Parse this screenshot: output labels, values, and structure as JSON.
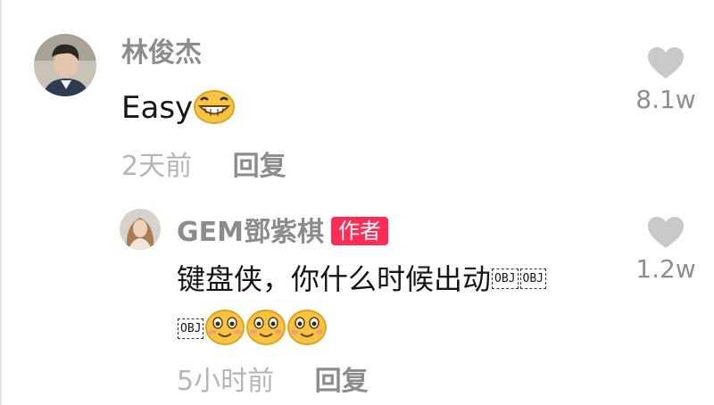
{
  "comments": [
    {
      "username": "林俊杰",
      "text": "Easy",
      "text_emoji": "grinning-face-emoji",
      "time": "2天前",
      "reply_label": "回复",
      "like_count": "8.1w",
      "like_icon": "heart-icon"
    },
    {
      "username": "GEM鄧紫棋",
      "badge": "作者",
      "text_line1": "键盘侠，你什么时候出动",
      "obj_marker": "OBJ",
      "emojis": [
        "smiling-face-emoji",
        "smiling-face-emoji",
        "smiling-face-emoji"
      ],
      "time": "5小时前",
      "reply_label": "回复",
      "like_count": "1.2w",
      "like_icon": "heart-icon"
    }
  ],
  "colors": {
    "badge": "#fe2c55",
    "username": "#8c8c8c",
    "time": "#b5b5b5",
    "heart": "#c9c9c9"
  }
}
